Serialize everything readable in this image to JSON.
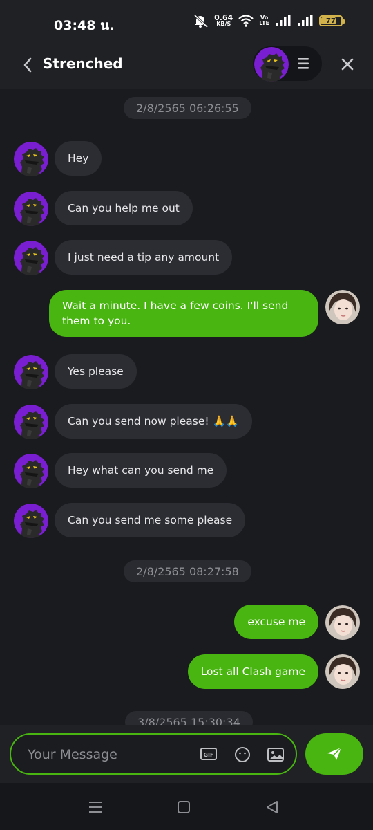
{
  "status_bar": {
    "time": "03:48 น.",
    "net_speed_value": "0.64",
    "net_speed_unit": "KB/S",
    "volte_line1": "Vo",
    "volte_line2": "LTE",
    "battery_level": "77"
  },
  "header": {
    "title": "Strenched",
    "back_icon": "chevron-left-icon",
    "menu_icon": "menu-lines-icon",
    "close_icon": "close-icon"
  },
  "messages": {
    "date1": "2/8/2565 06:26:55",
    "m1": "Hey",
    "m2": "Can you help me out",
    "m3": "I just need a tip any amount",
    "m4": "Wait a minute. I have a few coins. I'll send them to you.",
    "m5": "Yes please",
    "m6": "Can you send now please! 🙏🙏",
    "m7": "Hey what can you send me",
    "m8": "Can you send me some please",
    "date2": "2/8/2565 08:27:58",
    "m9": "excuse me",
    "m10": "Lost all Clash game",
    "date3": "3/8/2565 15:30:34"
  },
  "composer": {
    "placeholder": "Your Message",
    "gif_label": "GIF",
    "emoji_icon": "smiley-icon",
    "image_icon": "image-icon",
    "send_icon": "send-icon"
  },
  "colors": {
    "accent": "#48b511",
    "background": "#1a1b1f",
    "incoming_bubble": "#2c2d33",
    "header": "#202125"
  }
}
